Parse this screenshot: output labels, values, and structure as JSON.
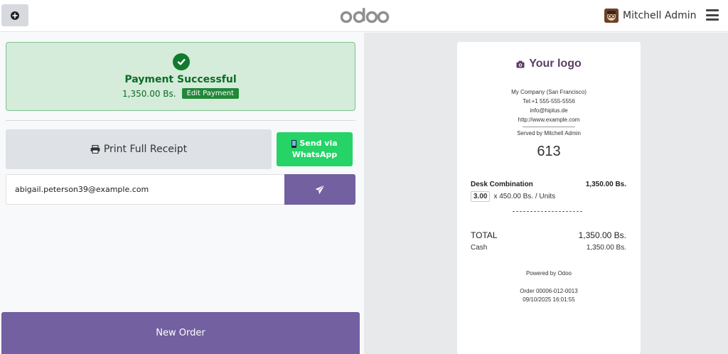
{
  "header": {
    "brand": "odoo",
    "user_name": "Mitchell Admin"
  },
  "payment": {
    "title": "Payment Successful",
    "amount": "1,350.00 Bs.",
    "edit_label": "Edit Payment"
  },
  "actions": {
    "print_label": "Print Full Receipt",
    "whatsapp_line1": "Send via",
    "whatsapp_line2": "WhatsApp",
    "email_value": "abigail.peterson39@example.com",
    "new_order_label": "New Order"
  },
  "receipt": {
    "logo_text": "Your logo",
    "company": "My Company (San Francisco)",
    "tel": "Tel:+1 555-555-5556",
    "email": "info@hiplus.de",
    "website": "http://www.example.com",
    "served_by": "Served by Mitchell Admin",
    "order_number": "613",
    "line": {
      "product": "Desk Combination",
      "price": "1,350.00 Bs.",
      "qty": "3.00",
      "unit_price": "x 450.00 Bs. / Units"
    },
    "total_label": "TOTAL",
    "total_value": "1,350.00 Bs.",
    "cash_label": "Cash",
    "cash_value": "1,350.00 Bs.",
    "powered_by": "Powered by Odoo",
    "order_ref": "Order 00006-012-0013",
    "datetime": "09/10/2025 16:01:55"
  },
  "colors": {
    "primary": "#7260a0",
    "success_bg": "#d4ecd9",
    "success_text": "#0d6b26",
    "whatsapp": "#25d366"
  }
}
